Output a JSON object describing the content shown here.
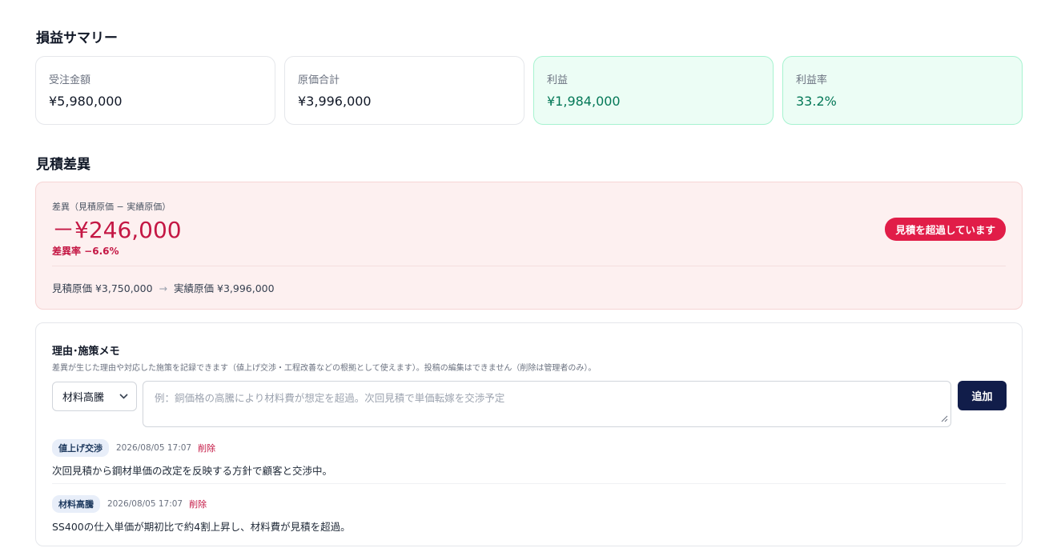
{
  "summary": {
    "title": "損益サマリー",
    "cards": [
      {
        "label": "受注金額",
        "value": "¥5,980,000"
      },
      {
        "label": "原価合計",
        "value": "¥3,996,000"
      },
      {
        "label": "利益",
        "value": "¥1,984,000"
      },
      {
        "label": "利益率",
        "value": "33.2%"
      }
    ]
  },
  "variance": {
    "title": "見積差異",
    "label": "差異（見積原価 − 実績原価）",
    "value": "－¥246,000",
    "rate": "差異率 −6.6%",
    "badge": "見積を超過しています",
    "estimate": "見積原価 ¥3,750,000",
    "arrow": "→",
    "actual": "実績原価 ¥3,996,000"
  },
  "memo": {
    "title": "理由･施策メモ",
    "description": "差異が生じた理由や対応した施策を記録できます（値上げ交渉・工程改善などの根拠として使えます）。投稿の編集はできません（削除は管理者のみ）。",
    "select_value": "材料高騰",
    "placeholder": "例：銅価格の高騰により材料費が想定を超過。次回見積で単価転嫁を交渉予定",
    "add_label": "追加",
    "entries": [
      {
        "tag": "値上げ交渉",
        "time": "2026/08/05 17:07",
        "delete_label": "削除",
        "text": "次回見積から鋼材単価の改定を反映する方針で顧客と交渉中。"
      },
      {
        "tag": "材料高騰",
        "time": "2026/08/05 17:07",
        "delete_label": "削除",
        "text": "SS400の仕入単価が期初比で約4割上昇し、材料費が見積を超過。"
      }
    ]
  }
}
